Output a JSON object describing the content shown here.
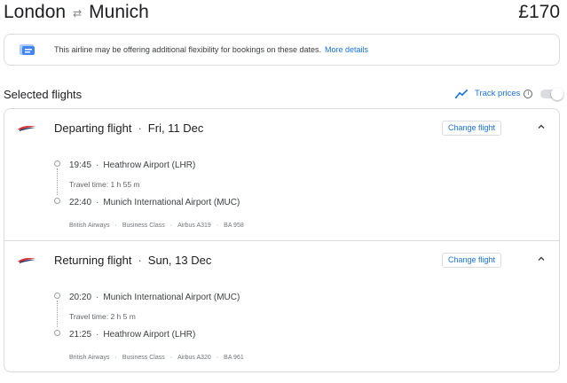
{
  "header": {
    "origin": "London",
    "destination": "Munich",
    "price": "£170"
  },
  "notice": {
    "text": "This airline may be offering additional flexibility for bookings on these dates.",
    "link": "More details"
  },
  "section": {
    "title": "Selected flights"
  },
  "track": {
    "label": "Track prices",
    "info": "i"
  },
  "departing": {
    "title": "Departing flight",
    "date": "Fri, 11 Dec",
    "change_label": "Change flight",
    "dep_time": "19:45",
    "dep_airport": "Heathrow Airport (LHR)",
    "travel_time": "Travel time: 1 h 55 m",
    "arr_time": "22:40",
    "arr_airport": "Munich International Airport (MUC)",
    "airline": "British Airways",
    "cabin": "Business Class",
    "aircraft": "Airbus A319",
    "flight_no": "BA 958"
  },
  "returning": {
    "title": "Returning flight",
    "date": "Sun, 13 Dec",
    "change_label": "Change flight",
    "dep_time": "20:20",
    "dep_airport": "Munich International Airport (MUC)",
    "travel_time": "Travel time: 2 h 5 m",
    "arr_time": "21:25",
    "arr_airport": "Heathrow Airport (LHR)",
    "airline": "British Airways",
    "cabin": "Business Class",
    "aircraft": "Airbus A320",
    "flight_no": "BA 961"
  },
  "colors": {
    "accent": "#1a73e8",
    "airline_red": "#d32f2f",
    "airline_blue": "#1f3b73",
    "border": "#dadce0"
  },
  "icons": {
    "swap": "swap-arrows-icon",
    "notice": "ticket-icon",
    "track": "trend-line-icon",
    "info": "info-icon",
    "chevron": "chevron-up-icon",
    "airline": "british-airways-logo"
  }
}
